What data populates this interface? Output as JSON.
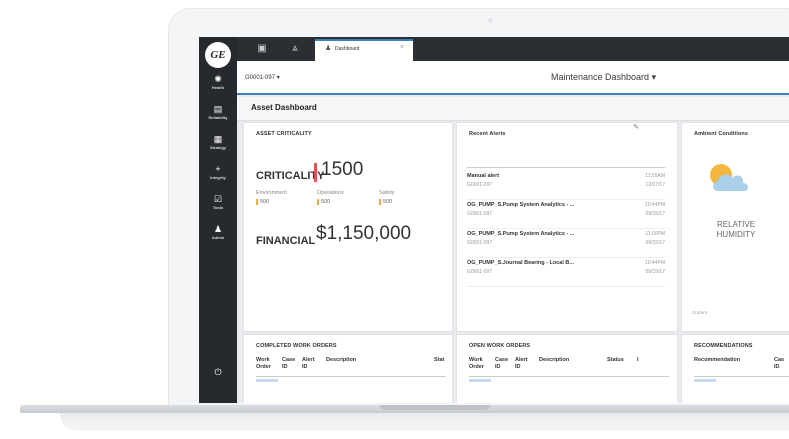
{
  "nav": {
    "logo_text": "GE",
    "items": [
      {
        "icon": "gear-icon",
        "glyph": "✺",
        "label": "Health"
      },
      {
        "icon": "grid-icon",
        "glyph": "▤",
        "label": "Reliability"
      },
      {
        "icon": "strategy-icon",
        "glyph": "▦",
        "label": "Strategy"
      },
      {
        "icon": "plus-icon",
        "glyph": "+",
        "label": "Integrity"
      },
      {
        "icon": "checklist-icon",
        "glyph": "☑",
        "label": "Tools"
      },
      {
        "icon": "user-icon",
        "glyph": "♟",
        "label": "Admin"
      }
    ],
    "power_icon": "⏻"
  },
  "tabs": {
    "icon1": "▣",
    "icon2": "⩓",
    "active_label": "Dashboard",
    "active_icon": "♟",
    "close": "×"
  },
  "header": {
    "asset": "G0001-097 ▾",
    "title": "Maintenance Dashboard ▾",
    "page_title": "Asset Dashboard"
  },
  "criticality": {
    "heading": "ASSET CRITICALITY",
    "label": "CRITICALITY",
    "value": "1500",
    "subs": [
      {
        "label": "Environment",
        "value": "500"
      },
      {
        "label": "Operations",
        "value": "500"
      },
      {
        "label": "Safety",
        "value": "500"
      }
    ],
    "financial_label": "FINANCIAL",
    "financial_value": "$1,150,000"
  },
  "alerts": {
    "heading": "Recent Alerts",
    "edit_icon": "✎",
    "items": [
      {
        "name": "Manual alert",
        "asset": "G0001-097",
        "time": "11:55AM",
        "date": "12/07/17"
      },
      {
        "name": "OG_PUMP_S.Pump System Analytics - ...",
        "asset": "G0001-097",
        "time": "10:44PM",
        "date": "09/15/17"
      },
      {
        "name": "OG_PUMP_S.Pump System Analytics - ...",
        "asset": "G0001-097",
        "time": "11:00PM",
        "date": "09/15/17"
      },
      {
        "name": "OG_PUMP_S.Journal Bearing - Local B...",
        "asset": "G0001-097",
        "time": "10:44PM",
        "date": "09/15/17"
      }
    ]
  },
  "ambient": {
    "heading": "Ambient Conditions",
    "line1": "RELATIVE",
    "line2": "HUMIDITY",
    "current": "Current"
  },
  "completed": {
    "heading": "COMPLETED WORK ORDERS",
    "cols": [
      "Work\nOrder",
      "Case\nID",
      "Alert\nID",
      "Description",
      "Stat"
    ]
  },
  "open": {
    "heading": "OPEN WORK ORDERS",
    "cols": [
      "Work\nOrder",
      "Case\nID",
      "Alert\nID",
      "Description",
      "Status",
      "I"
    ]
  },
  "recs": {
    "heading": "RECOMMENDATIONS",
    "cols": [
      "Recommendation",
      "Cas\nID"
    ]
  }
}
